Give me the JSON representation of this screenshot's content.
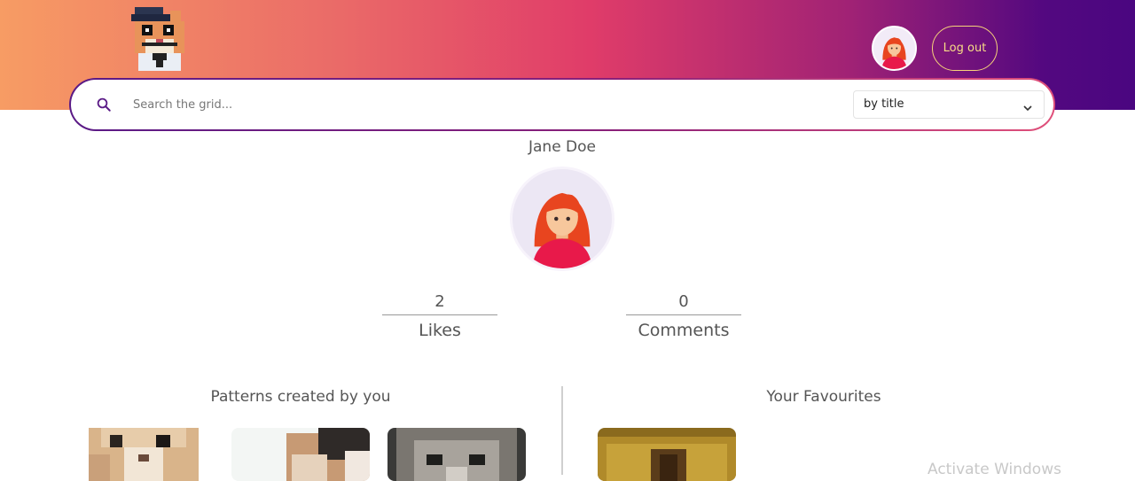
{
  "header": {
    "logo_icon": "pixel-cat-with-beret-logo",
    "avatar_icon": "red-haired-woman-avatar",
    "logout_label": "Log out",
    "colors": {
      "gradient_start": "#f79c64",
      "gradient_mid": "#e03c69",
      "gradient_end": "#4a0680",
      "logout_accent": "#f8dd86"
    }
  },
  "search": {
    "icon": "search-icon",
    "placeholder": "Search the grid...",
    "filter_selected": "by title"
  },
  "profile": {
    "name": "Jane Doe",
    "avatar_icon": "red-haired-woman-avatar"
  },
  "stats": {
    "likes": {
      "value": "2",
      "label": "Likes"
    },
    "comments": {
      "value": "0",
      "label": "Comments"
    }
  },
  "sections": {
    "created_title": "Patterns created by you",
    "favourites_title": "Your Favourites"
  },
  "watermark": "Activate Windows"
}
